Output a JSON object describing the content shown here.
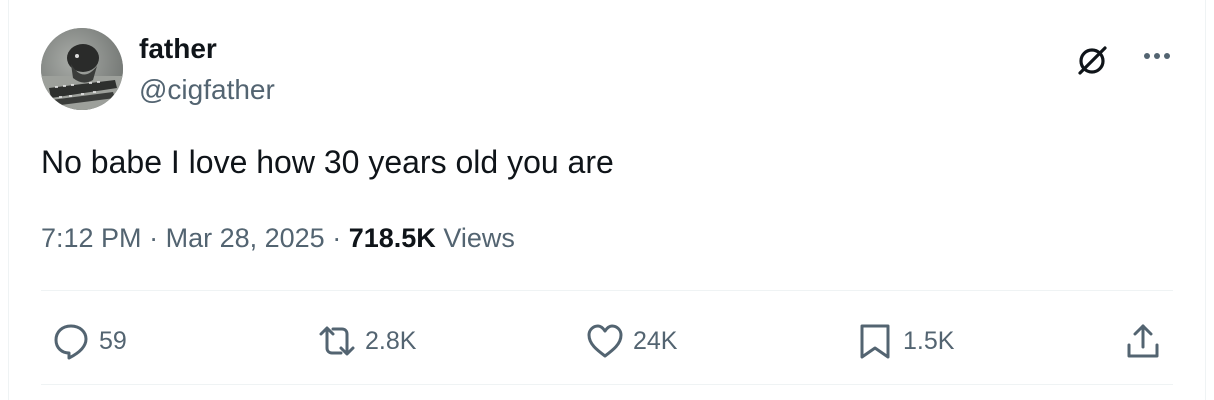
{
  "author": {
    "display_name": "father",
    "handle": "@cigfather"
  },
  "tweet": {
    "text": "No babe I love how 30 years old you are",
    "time": "7:12 PM",
    "separator": "·",
    "date": "Mar 28, 2025",
    "views_count": "718.5K",
    "views_label": "Views"
  },
  "actions": {
    "replies": "59",
    "reposts": "2.8K",
    "likes": "24K",
    "bookmarks": "1.5K"
  },
  "icons": {
    "grok": "grok-icon",
    "more": "more-horizontal-icon",
    "reply": "reply-icon",
    "repost": "repost-icon",
    "like": "heart-icon",
    "bookmark": "bookmark-icon",
    "share": "share-icon"
  },
  "colors": {
    "text_primary": "#0f1419",
    "text_secondary": "#536471",
    "divider": "#eff3f4"
  }
}
